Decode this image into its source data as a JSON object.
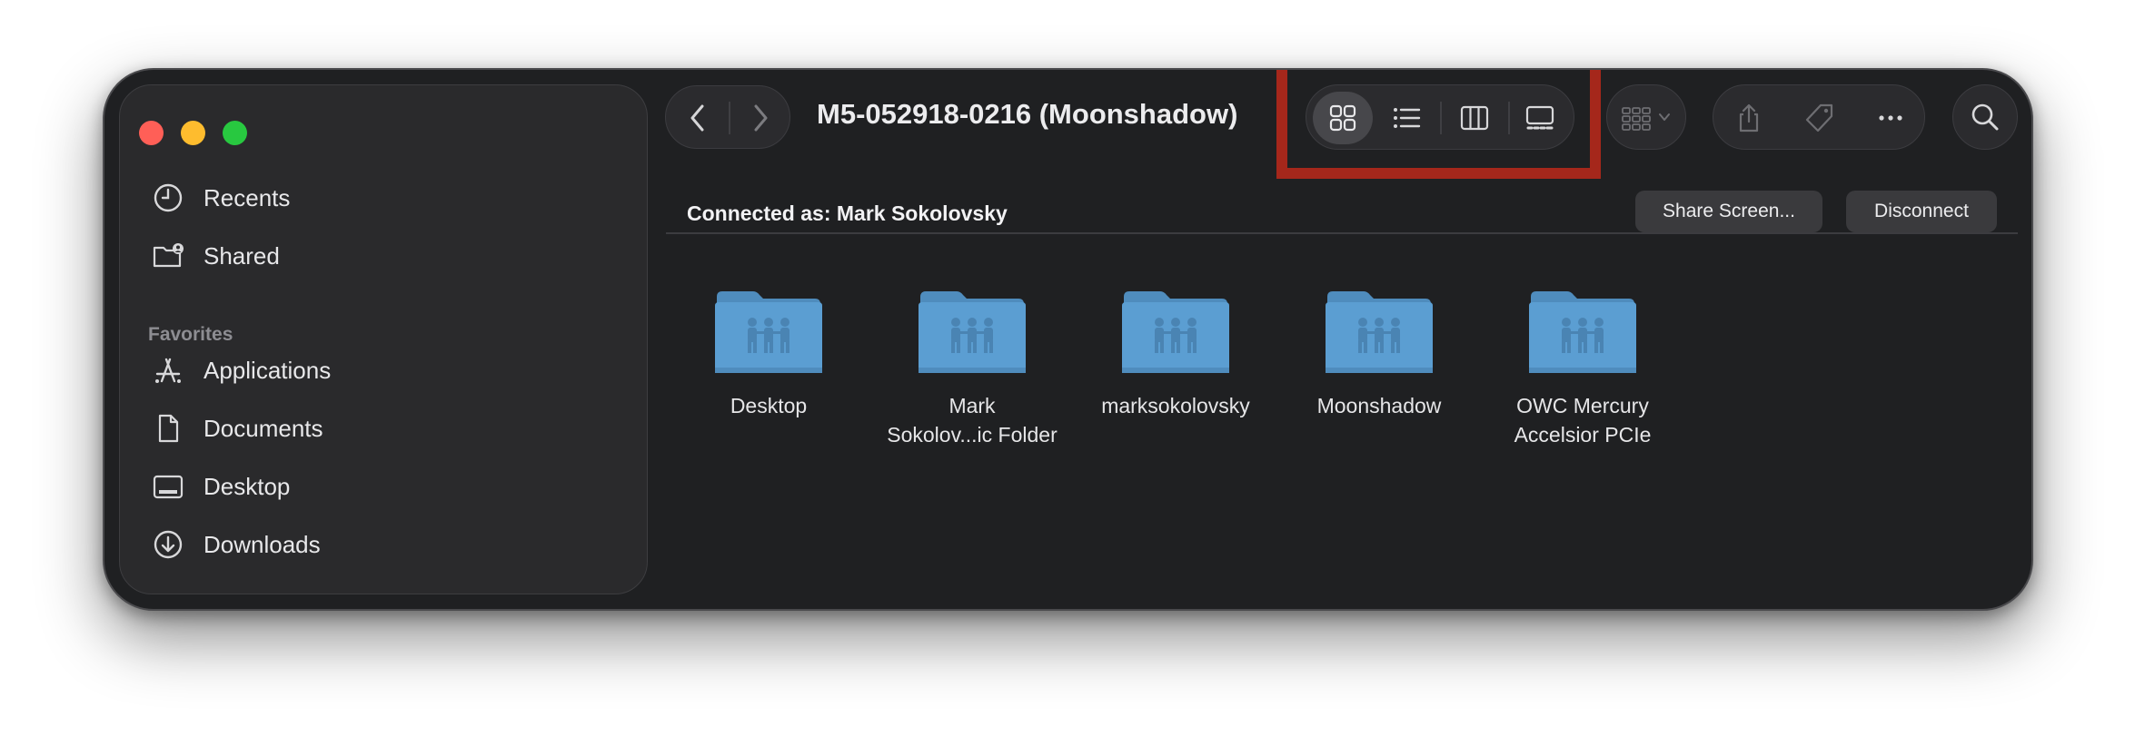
{
  "window": {
    "title": "M5-052918-0216 (Moonshadow)"
  },
  "sidebar": {
    "items_top": [
      {
        "label": "Recents",
        "icon": "clock-icon"
      },
      {
        "label": "Shared",
        "icon": "shared-folder-icon"
      }
    ],
    "favorites_heading": "Favorites",
    "favorites": [
      {
        "label": "Applications",
        "icon": "applications-icon"
      },
      {
        "label": "Documents",
        "icon": "document-icon"
      },
      {
        "label": "Desktop",
        "icon": "desktop-icon"
      },
      {
        "label": "Downloads",
        "icon": "download-icon"
      }
    ]
  },
  "toolbar": {
    "view_modes": [
      {
        "name": "icon-view",
        "icon": "grid-icon",
        "selected": true
      },
      {
        "name": "list-view",
        "icon": "list-icon",
        "selected": false
      },
      {
        "name": "column-view",
        "icon": "columns-icon",
        "selected": false
      },
      {
        "name": "gallery-view",
        "icon": "gallery-icon",
        "selected": false
      }
    ],
    "highlight_color": "#a5271b"
  },
  "connection": {
    "label": "Connected as: Mark Sokolovsky",
    "share_screen_label": "Share Screen...",
    "disconnect_label": "Disconnect"
  },
  "files": [
    {
      "label": "Desktop"
    },
    {
      "label": "Mark\nSokolov...ic Folder"
    },
    {
      "label": "marksokolovsky"
    },
    {
      "label": "Moonshadow"
    },
    {
      "label": "OWC Mercury\nAccelsior PCIe"
    }
  ],
  "colors": {
    "folder_top": "#6aa6d6",
    "folder_body": "#5b9ed2",
    "window_bg": "#1f2022",
    "sidebar_bg": "#2a2a2c"
  }
}
